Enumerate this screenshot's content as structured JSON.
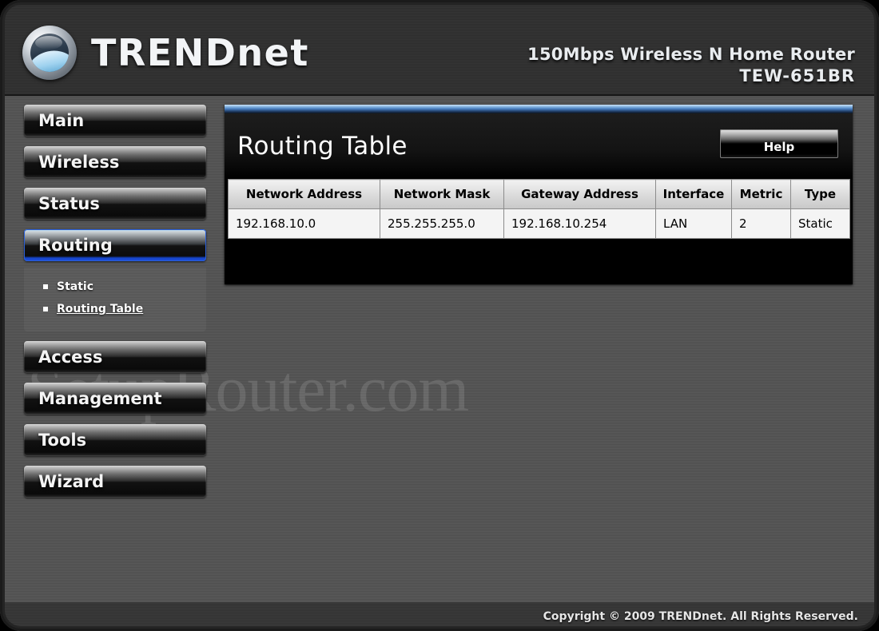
{
  "header": {
    "brand_name": "TRENDnet",
    "brand_upper": "TREND",
    "brand_lower": "net",
    "logo_icon": "trendnet-wave-globe-icon",
    "product_line": "150Mbps Wireless N Home Router",
    "model": "TEW-651BR"
  },
  "watermark": {
    "text": "SetupRouter.com"
  },
  "sidebar": {
    "items": [
      {
        "label": "Main",
        "active": false
      },
      {
        "label": "Wireless",
        "active": false
      },
      {
        "label": "Status",
        "active": false
      },
      {
        "label": "Routing",
        "active": true
      },
      {
        "label": "Access",
        "active": false
      },
      {
        "label": "Management",
        "active": false
      },
      {
        "label": "Tools",
        "active": false
      },
      {
        "label": "Wizard",
        "active": false
      }
    ],
    "submenu": {
      "parent": "Routing",
      "items": [
        {
          "label": "Static",
          "current": false
        },
        {
          "label": "Routing Table",
          "current": true
        }
      ]
    }
  },
  "panel": {
    "title": "Routing Table",
    "help_label": "Help",
    "accent_color": "#4a7fc0"
  },
  "table": {
    "columns": [
      "Network Address",
      "Network Mask",
      "Gateway Address",
      "Interface",
      "Metric",
      "Type"
    ],
    "rows": [
      {
        "network_address": "192.168.10.0",
        "network_mask": "255.255.255.0",
        "gateway_address": "192.168.10.254",
        "interface": "LAN",
        "metric": "2",
        "type": "Static"
      }
    ]
  },
  "footer": {
    "copyright": "Copyright © 2009 TRENDnet. All Rights Reserved."
  }
}
